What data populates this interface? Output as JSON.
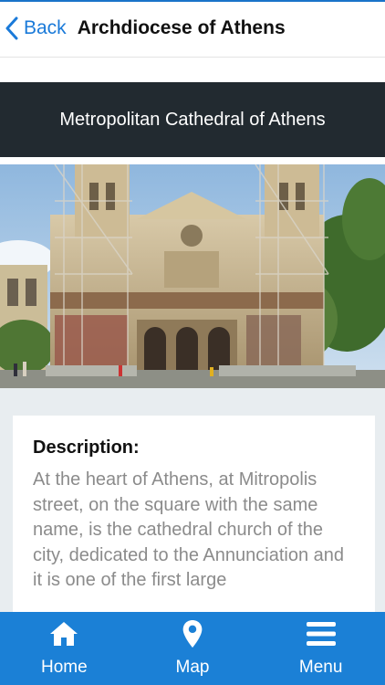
{
  "nav": {
    "back_label": "Back",
    "title": "Archdiocese of Athens"
  },
  "header": {
    "title": "Metropolitan Cathedral of Athens"
  },
  "description": {
    "heading": "Description:",
    "text": "At the heart of Athens, at Mitropolis street, on the square with the same name, is the cathedral church of the city, dedicated to the Annunciation and it is one of the first large"
  },
  "tabs": [
    {
      "label": "Home",
      "icon": "home-icon"
    },
    {
      "label": "Map",
      "icon": "map-pin-icon"
    },
    {
      "label": "Menu",
      "icon": "menu-icon"
    }
  ],
  "colors": {
    "accent": "#1a7ad9",
    "tabbar": "#1b80d6",
    "header_band": "#222a30",
    "content_bg": "#e8edf0"
  }
}
